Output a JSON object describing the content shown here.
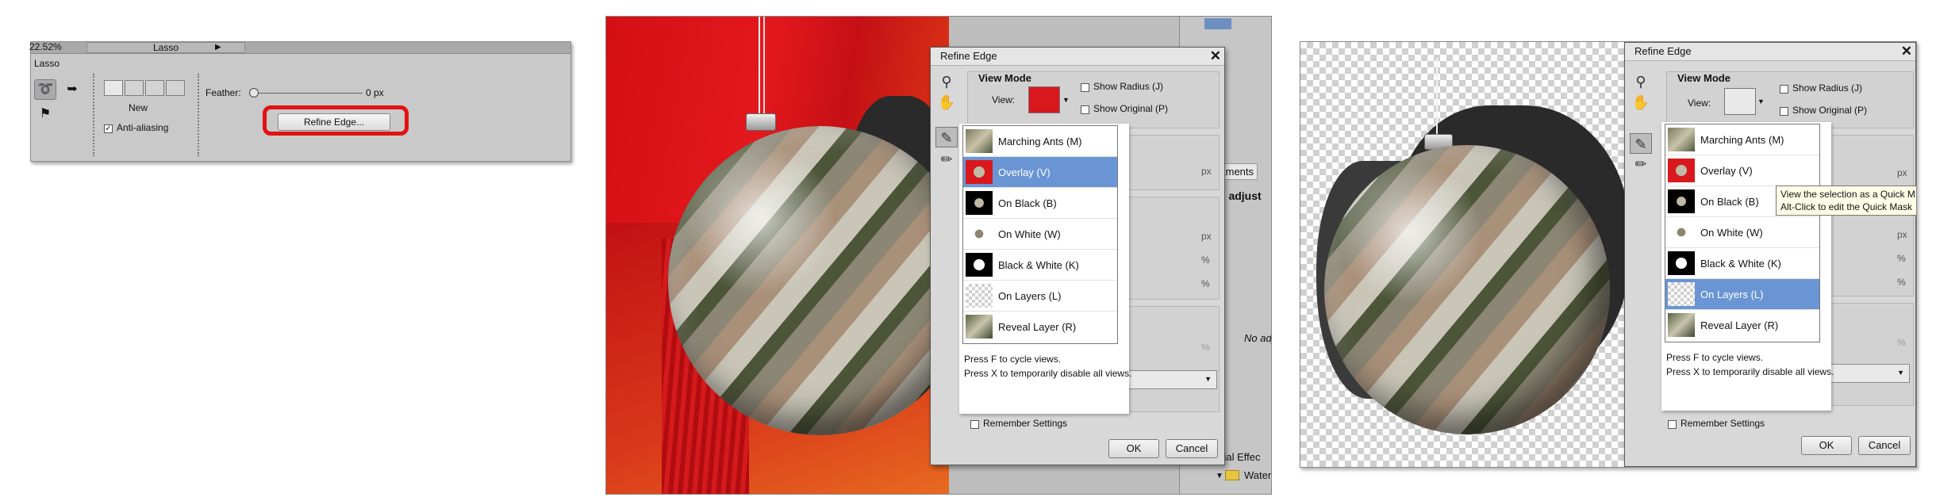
{
  "options_bar": {
    "zoom": "22.52%",
    "tab_title": "Lasso",
    "tool_name": "Lasso",
    "new_label": "New",
    "feather_label": "Feather:",
    "feather_value": "0 px",
    "antialias_label": "Anti-aliasing",
    "antialias_checked": true,
    "refine_button": "Refine Edge..."
  },
  "dialog_overlay": {
    "title": "Refine Edge",
    "view_mode_label": "View Mode",
    "view_label": "View:",
    "show_radius": "Show Radius (J)",
    "show_original": "Show Original (P)",
    "menu_items": [
      {
        "label": "Marching Ants (M)",
        "selected": false
      },
      {
        "label": "Overlay (V)",
        "selected": true
      },
      {
        "label": "On Black (B)",
        "selected": false
      },
      {
        "label": "On White (W)",
        "selected": false
      },
      {
        "label": "Black & White (K)",
        "selected": false
      },
      {
        "label": "On Layers (L)",
        "selected": false
      },
      {
        "label": "Reveal Layer (R)",
        "selected": false
      }
    ],
    "hint1": "Press F to cycle views.",
    "hint2": "Press X to temporarily disable all views.",
    "unit_px1": "px",
    "unit_px2": "px",
    "unit_pct1": "%",
    "unit_pct2": "%",
    "remember": "Remember Settings",
    "ok": "OK",
    "cancel": "Cancel"
  },
  "background_app": {
    "tab_adjustments": "tments",
    "adjust_label": "n adjust",
    "no_adj": "No adj",
    "special_effects": "cial Effec",
    "watercolor": "Watercolor A"
  },
  "dialog_layers": {
    "title": "Refine Edge",
    "view_mode_label": "View Mode",
    "view_label": "View:",
    "show_radius": "Show Radius (J)",
    "show_original": "Show Original (P)",
    "menu_items": [
      {
        "label": "Marching Ants (M)",
        "selected": false
      },
      {
        "label": "Overlay (V)",
        "selected": false
      },
      {
        "label": "On Black (B)",
        "selected": false
      },
      {
        "label": "On White (W)",
        "selected": false
      },
      {
        "label": "Black & White (K)",
        "selected": false
      },
      {
        "label": "On Layers (L)",
        "selected": true
      },
      {
        "label": "Reveal Layer (R)",
        "selected": false
      }
    ],
    "tooltip_line1": "View the selection as a Quick M",
    "tooltip_line2": "Alt-Click to edit the Quick Mask",
    "hint1": "Press F to cycle views.",
    "hint2": "Press X to temporarily disable all views.",
    "unit_px1": "px",
    "unit_px2": "px",
    "unit_pct1": "%",
    "unit_pct2": "%",
    "remember": "Remember Settings",
    "ok": "OK",
    "cancel": "Cancel"
  },
  "colors": {
    "highlight": "#e31212",
    "selection": "#6a95d4",
    "overlay_red": "#e3181c"
  }
}
